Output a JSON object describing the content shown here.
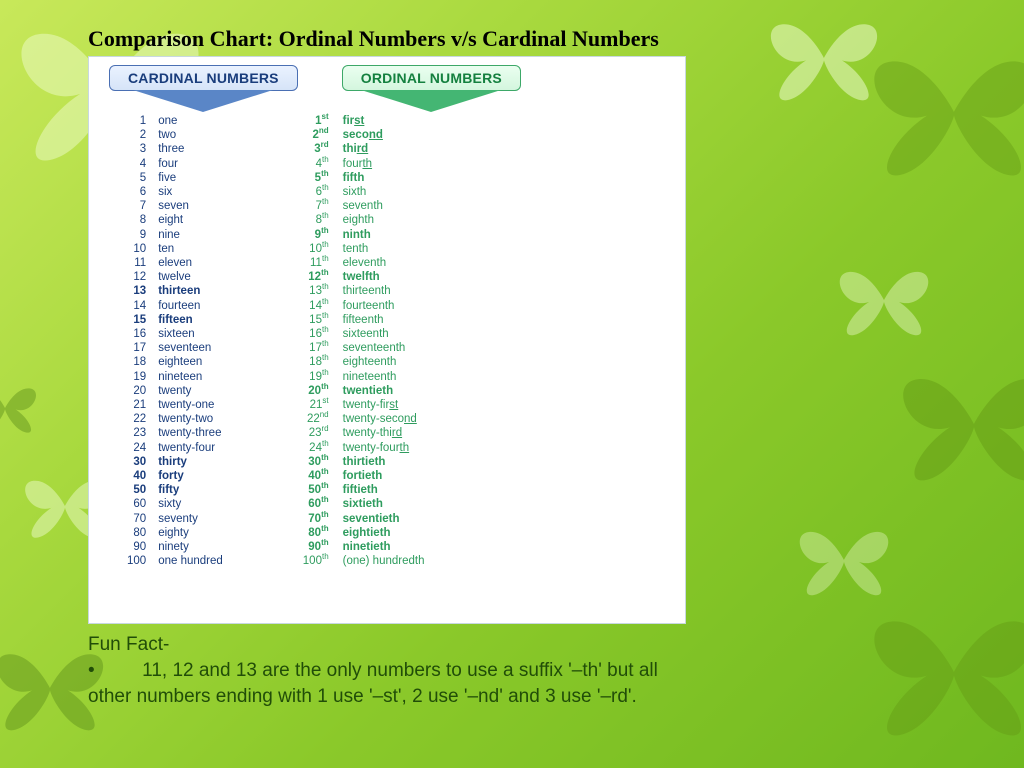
{
  "title": "Comparison Chart: Ordinal Numbers v/s Cardinal Numbers",
  "headers": {
    "cardinal": "CARDINAL NUMBERS",
    "ordinal": "ORDINAL NUMBERS"
  },
  "funfact": {
    "heading": "Fun Fact-",
    "body": "•         11, 12 and 13 are the only numbers to use a suffix '–th' but all other numbers ending with 1 use '–st', 2 use '–nd' and 3 use '–rd'."
  },
  "chart_data": {
    "type": "table",
    "title": "Cardinal vs Ordinal Numbers",
    "columns": [
      "number",
      "cardinal_word",
      "ordinal_short",
      "ordinal_suffix",
      "ordinal_word",
      "cardinal_bold",
      "ordinal_bold",
      "underline_tail"
    ],
    "rows": [
      {
        "number": "1",
        "cardinal_word": "one",
        "ordinal_short": "1",
        "ordinal_suffix": "st",
        "ordinal_word": "first",
        "cardinal_bold": false,
        "ordinal_bold": true,
        "underline_tail": "st"
      },
      {
        "number": "2",
        "cardinal_word": "two",
        "ordinal_short": "2",
        "ordinal_suffix": "nd",
        "ordinal_word": "second",
        "cardinal_bold": false,
        "ordinal_bold": true,
        "underline_tail": "nd"
      },
      {
        "number": "3",
        "cardinal_word": "three",
        "ordinal_short": "3",
        "ordinal_suffix": "rd",
        "ordinal_word": "third",
        "cardinal_bold": false,
        "ordinal_bold": true,
        "underline_tail": "rd"
      },
      {
        "number": "4",
        "cardinal_word": "four",
        "ordinal_short": "4",
        "ordinal_suffix": "th",
        "ordinal_word": "fourth",
        "cardinal_bold": false,
        "ordinal_bold": false,
        "underline_tail": "th"
      },
      {
        "number": "5",
        "cardinal_word": "five",
        "ordinal_short": "5",
        "ordinal_suffix": "th",
        "ordinal_word": "fifth",
        "cardinal_bold": false,
        "ordinal_bold": true,
        "underline_tail": ""
      },
      {
        "number": "6",
        "cardinal_word": "six",
        "ordinal_short": "6",
        "ordinal_suffix": "th",
        "ordinal_word": "sixth",
        "cardinal_bold": false,
        "ordinal_bold": false,
        "underline_tail": ""
      },
      {
        "number": "7",
        "cardinal_word": "seven",
        "ordinal_short": "7",
        "ordinal_suffix": "th",
        "ordinal_word": "seventh",
        "cardinal_bold": false,
        "ordinal_bold": false,
        "underline_tail": ""
      },
      {
        "number": "8",
        "cardinal_word": "eight",
        "ordinal_short": "8",
        "ordinal_suffix": "th",
        "ordinal_word": "eighth",
        "cardinal_bold": false,
        "ordinal_bold": false,
        "underline_tail": ""
      },
      {
        "number": "9",
        "cardinal_word": "nine",
        "ordinal_short": "9",
        "ordinal_suffix": "th",
        "ordinal_word": "ninth",
        "cardinal_bold": false,
        "ordinal_bold": true,
        "underline_tail": ""
      },
      {
        "number": "10",
        "cardinal_word": "ten",
        "ordinal_short": "10",
        "ordinal_suffix": "th",
        "ordinal_word": "tenth",
        "cardinal_bold": false,
        "ordinal_bold": false,
        "underline_tail": ""
      },
      {
        "number": "11",
        "cardinal_word": "eleven",
        "ordinal_short": "11",
        "ordinal_suffix": "th",
        "ordinal_word": "eleventh",
        "cardinal_bold": false,
        "ordinal_bold": false,
        "underline_tail": ""
      },
      {
        "number": "12",
        "cardinal_word": "twelve",
        "ordinal_short": "12",
        "ordinal_suffix": "th",
        "ordinal_word": "twelfth",
        "cardinal_bold": false,
        "ordinal_bold": true,
        "underline_tail": ""
      },
      {
        "number": "13",
        "cardinal_word": "thirteen",
        "ordinal_short": "13",
        "ordinal_suffix": "th",
        "ordinal_word": "thirteenth",
        "cardinal_bold": true,
        "ordinal_bold": false,
        "underline_tail": ""
      },
      {
        "number": "14",
        "cardinal_word": "fourteen",
        "ordinal_short": "14",
        "ordinal_suffix": "th",
        "ordinal_word": "fourteenth",
        "cardinal_bold": false,
        "ordinal_bold": false,
        "underline_tail": ""
      },
      {
        "number": "15",
        "cardinal_word": "fifteen",
        "ordinal_short": "15",
        "ordinal_suffix": "th",
        "ordinal_word": "fifteenth",
        "cardinal_bold": true,
        "ordinal_bold": false,
        "underline_tail": ""
      },
      {
        "number": "16",
        "cardinal_word": "sixteen",
        "ordinal_short": "16",
        "ordinal_suffix": "th",
        "ordinal_word": "sixteenth",
        "cardinal_bold": false,
        "ordinal_bold": false,
        "underline_tail": ""
      },
      {
        "number": "17",
        "cardinal_word": "seventeen",
        "ordinal_short": "17",
        "ordinal_suffix": "th",
        "ordinal_word": "seventeenth",
        "cardinal_bold": false,
        "ordinal_bold": false,
        "underline_tail": ""
      },
      {
        "number": "18",
        "cardinal_word": "eighteen",
        "ordinal_short": "18",
        "ordinal_suffix": "th",
        "ordinal_word": "eighteenth",
        "cardinal_bold": false,
        "ordinal_bold": false,
        "underline_tail": ""
      },
      {
        "number": "19",
        "cardinal_word": "nineteen",
        "ordinal_short": "19",
        "ordinal_suffix": "th",
        "ordinal_word": "nineteenth",
        "cardinal_bold": false,
        "ordinal_bold": false,
        "underline_tail": ""
      },
      {
        "number": "20",
        "cardinal_word": "twenty",
        "ordinal_short": "20",
        "ordinal_suffix": "th",
        "ordinal_word": "twentieth",
        "cardinal_bold": false,
        "ordinal_bold": true,
        "underline_tail": ""
      },
      {
        "number": "21",
        "cardinal_word": "twenty-one",
        "ordinal_short": "21",
        "ordinal_suffix": "st",
        "ordinal_word": "twenty-first",
        "cardinal_bold": false,
        "ordinal_bold": false,
        "underline_tail": "st"
      },
      {
        "number": "22",
        "cardinal_word": "twenty-two",
        "ordinal_short": "22",
        "ordinal_suffix": "nd",
        "ordinal_word": "twenty-second",
        "cardinal_bold": false,
        "ordinal_bold": false,
        "underline_tail": "nd"
      },
      {
        "number": "23",
        "cardinal_word": "twenty-three",
        "ordinal_short": "23",
        "ordinal_suffix": "rd",
        "ordinal_word": "twenty-third",
        "cardinal_bold": false,
        "ordinal_bold": false,
        "underline_tail": "rd"
      },
      {
        "number": "24",
        "cardinal_word": "twenty-four",
        "ordinal_short": "24",
        "ordinal_suffix": "th",
        "ordinal_word": "twenty-fourth",
        "cardinal_bold": false,
        "ordinal_bold": false,
        "underline_tail": "th"
      },
      {
        "number": "30",
        "cardinal_word": "thirty",
        "ordinal_short": "30",
        "ordinal_suffix": "th",
        "ordinal_word": "thirtieth",
        "cardinal_bold": true,
        "ordinal_bold": true,
        "underline_tail": ""
      },
      {
        "number": "40",
        "cardinal_word": "forty",
        "ordinal_short": "40",
        "ordinal_suffix": "th",
        "ordinal_word": "fortieth",
        "cardinal_bold": true,
        "ordinal_bold": true,
        "underline_tail": ""
      },
      {
        "number": "50",
        "cardinal_word": "fifty",
        "ordinal_short": "50",
        "ordinal_suffix": "th",
        "ordinal_word": "fiftieth",
        "cardinal_bold": true,
        "ordinal_bold": true,
        "underline_tail": ""
      },
      {
        "number": "60",
        "cardinal_word": "sixty",
        "ordinal_short": "60",
        "ordinal_suffix": "th",
        "ordinal_word": "sixtieth",
        "cardinal_bold": false,
        "ordinal_bold": true,
        "underline_tail": ""
      },
      {
        "number": "70",
        "cardinal_word": "seventy",
        "ordinal_short": "70",
        "ordinal_suffix": "th",
        "ordinal_word": "seventieth",
        "cardinal_bold": false,
        "ordinal_bold": true,
        "underline_tail": ""
      },
      {
        "number": "80",
        "cardinal_word": "eighty",
        "ordinal_short": "80",
        "ordinal_suffix": "th",
        "ordinal_word": "eightieth",
        "cardinal_bold": false,
        "ordinal_bold": true,
        "underline_tail": ""
      },
      {
        "number": "90",
        "cardinal_word": "ninety",
        "ordinal_short": "90",
        "ordinal_suffix": "th",
        "ordinal_word": "ninetieth",
        "cardinal_bold": false,
        "ordinal_bold": true,
        "underline_tail": ""
      },
      {
        "number": "100",
        "cardinal_word": "one hundred",
        "ordinal_short": "100",
        "ordinal_suffix": "th",
        "ordinal_word": "(one) hundredth",
        "cardinal_bold": false,
        "ordinal_bold": false,
        "underline_tail": ""
      }
    ]
  }
}
